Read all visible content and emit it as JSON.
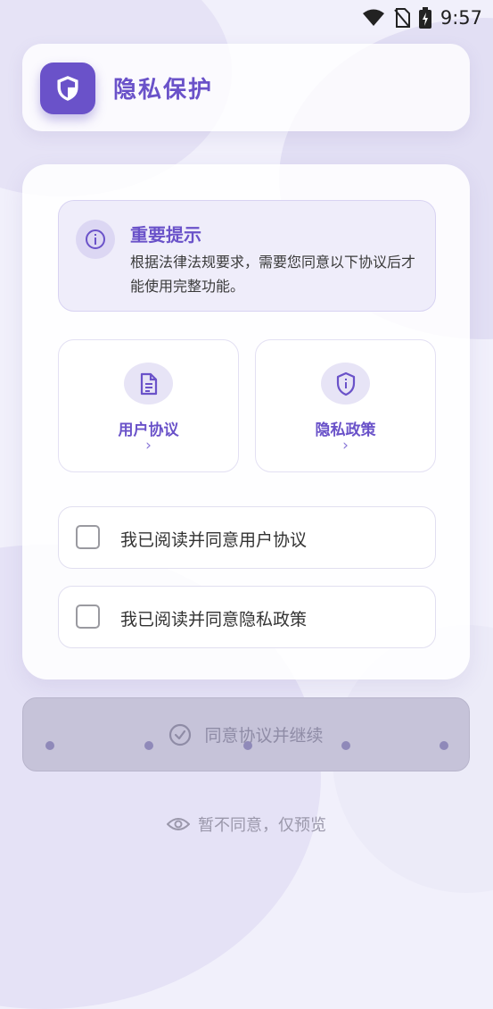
{
  "status_bar": {
    "time": "9:57"
  },
  "header": {
    "title": "隐私保护",
    "icon": "shield-icon"
  },
  "notice": {
    "title": "重要提示",
    "text": "根据法律法规要求，需要您同意以下协议后才能使用完整功能。",
    "icon": "info-icon"
  },
  "documents": [
    {
      "label": "用户协议",
      "icon": "document-icon",
      "chevron": "›"
    },
    {
      "label": "隐私政策",
      "icon": "shield-info-icon",
      "chevron": "›"
    }
  ],
  "agreements": [
    {
      "label": "我已阅读并同意用户协议",
      "checked": false
    },
    {
      "label": "我已阅读并同意隐私政策",
      "checked": false
    }
  ],
  "continue_button": {
    "label": "同意协议并继续",
    "icon": "check-circle-icon",
    "enabled": false
  },
  "skip_link": {
    "label": "暂不同意，仅预览",
    "icon": "eye-icon"
  },
  "colors": {
    "accent": "#6a52c9",
    "background": "#f1f0fb",
    "disabled_button": "#c6c3d9"
  }
}
